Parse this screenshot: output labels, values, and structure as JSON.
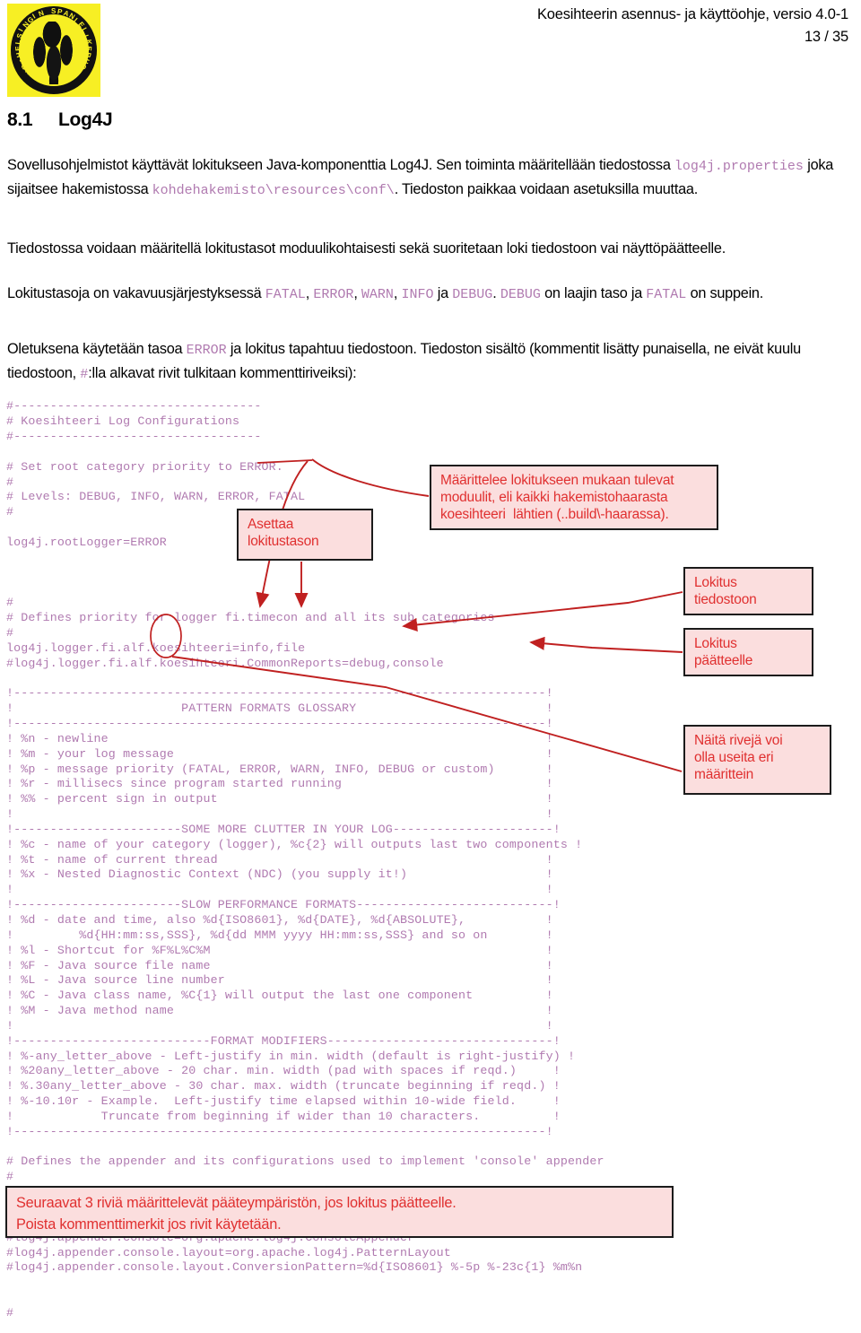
{
  "header": {
    "title": "Koesihteerin asennus- ja käyttöohje, versio 4.0-1",
    "page": "13 / 35",
    "logo_name": "suur-helsingin-spanielikerho-logo"
  },
  "section": {
    "number": "8.1",
    "title": "Log4J"
  },
  "paragraphs": {
    "p1_a": "Sovellusohjelmistot käyttävät lokitukseen Java-komponenttia Log4J. Sen toiminta määritellään tiedostossa ",
    "p1_code1": "log4j.properties",
    "p1_b": " joka sijaitsee hakemistossa ",
    "p1_code2": "kohdehakemisto\\resources\\conf\\",
    "p1_c": ". Tiedoston paikkaa voidaan asetuksilla muuttaa.",
    "p2": "Tiedostossa voidaan määritellä lokitustasot moduulikohtaisesti sekä suoritetaan loki tiedostoon vai näyttöpäätteelle.",
    "p3_a": "Lokitustasoja on vakavuusjärjestyksessä ",
    "p3_fatal": "FATAL",
    "p3_sep1": ", ",
    "p3_error": "ERROR",
    "p3_sep2": ", ",
    "p3_warn": "WARN",
    "p3_sep3": ", ",
    "p3_info": "INFO",
    "p3_b": " ja ",
    "p3_debug": "DEBUG",
    "p3_c": ". ",
    "p3_debug2": "DEBUG",
    "p3_d": " on laajin taso ja ",
    "p3_fatal2": "FATAL",
    "p3_e": " on suppein.",
    "p4_a": "Oletuksena käytetään tasoa ",
    "p4_error": "ERROR",
    "p4_b": " ja lokitus tapahtuu tiedostoon. Tiedoston sisältö (kommentit lisätty punaisella, ne eivät kuulu tiedostoon, ",
    "p4_hash": "#",
    "p4_c": ":lla alkavat rivit tulkitaan kommenttiriveiksi):"
  },
  "code_lines": [
    "#----------------------------------",
    "# Koesihteeri Log Configurations",
    "#----------------------------------",
    "",
    "# Set root category priority to ERROR.",
    "#",
    "# Levels: DEBUG, INFO, WARN, ERROR, FATAL",
    "#",
    "",
    "log4j.rootLogger=ERROR",
    "",
    "",
    "",
    "#",
    "# Defines priority for logger fi.timecon and all its sub categories",
    "#",
    "log4j.logger.fi.alf.koesihteeri=info,file",
    "#log4j.logger.fi.alf.koesihteeri.CommonReports=debug,console",
    "",
    "!-------------------------------------------------------------------------!",
    "!                       PATTERN FORMATS GLOSSARY                          !",
    "!-------------------------------------------------------------------------!",
    "! %n - newline                                                            !",
    "! %m - your log message                                                   !",
    "! %p - message priority (FATAL, ERROR, WARN, INFO, DEBUG or custom)       !",
    "! %r - millisecs since program started running                            !",
    "! %% - percent sign in output                                             !",
    "!                                                                         !",
    "!-----------------------SOME MORE CLUTTER IN YOUR LOG----------------------!",
    "! %c - name of your category (logger), %c{2} will outputs last two components !",
    "! %t - name of current thread                                             !",
    "! %x - Nested Diagnostic Context (NDC) (you supply it!)                   !",
    "!                                                                         !",
    "!-----------------------SLOW PERFORMANCE FORMATS---------------------------!",
    "! %d - date and time, also %d{ISO8601}, %d{DATE}, %d{ABSOLUTE},           !",
    "!         %d{HH:mm:ss,SSS}, %d{dd MMM yyyy HH:mm:ss,SSS} and so on        !",
    "! %l - Shortcut for %F%L%C%M                                              !",
    "! %F - Java source file name                                              !",
    "! %L - Java source line number                                            !",
    "! %C - Java class name, %C{1} will output the last one component          !",
    "! %M - Java method name                                                   !",
    "!                                                                         !",
    "!---------------------------FORMAT MODIFIERS-------------------------------!",
    "! %-any_letter_above - Left-justify in min. width (default is right-justify) !",
    "! %20any_letter_above - 20 char. min. width (pad with spaces if reqd.)     !",
    "! %.30any_letter_above - 30 char. max. width (truncate beginning if reqd.) !",
    "! %-10.10r - Example.  Left-justify time elapsed within 10-wide field.     !",
    "!            Truncate from beginning if wider than 10 characters.          !",
    "!-------------------------------------------------------------------------!",
    "",
    "# Defines the appender and its configurations used to implement 'console' appender",
    "#",
    "",
    "",
    "",
    "#log4j.appender.console=org.apache.log4j.ConsoleAppender",
    "#log4j.appender.console.layout=org.apache.log4j.PatternLayout",
    "#log4j.appender.console.layout.ConversionPattern=%d{ISO8601} %-5p %-23c{1} %m%n",
    "",
    "",
    "#"
  ],
  "callouts": {
    "moduulit": [
      "Määrittelee lokitukseen mukaan tulevat",
      "moduulit, eli kaikki hakemistohaarasta",
      "koesihteeri  lähtien (..build\\-haarassa)."
    ],
    "asettaa": [
      "Asettaa",
      "lokitustason"
    ],
    "tiedostoon": [
      "Lokitus",
      "tiedostoon"
    ],
    "paatteelle": [
      "Lokitus",
      "päätteelle"
    ],
    "useita": [
      "Näitä rivejä voi",
      "olla useita eri",
      "määrittein"
    ],
    "seuraavat": [
      "Seuraavat 3 riviä määrittelevät pääteympäristön, jos lokitus päätteelle.",
      "Poista kommenttimerkit jos rivit käytetään."
    ]
  },
  "colors": {
    "annotation_red": "#e03030",
    "annotation_fill": "#fbdede",
    "code_mauve": "#b07ab0",
    "logo_yellow": "#f7ef24"
  }
}
